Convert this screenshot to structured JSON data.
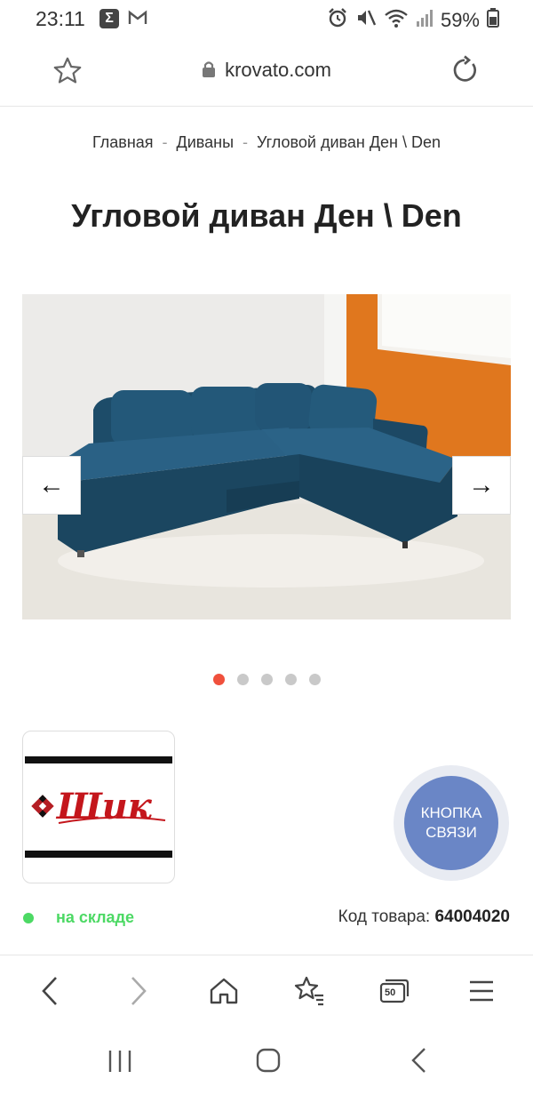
{
  "status_bar": {
    "time": "23:11",
    "battery": "59%",
    "icons": [
      "sigma-icon",
      "gmail-icon",
      "alarm-icon",
      "mute-icon",
      "wifi-icon",
      "signal-icon",
      "battery-icon"
    ]
  },
  "url_bar": {
    "url": "krovato.com"
  },
  "breadcrumb": {
    "items": [
      "Главная",
      "Диваны",
      "Угловой диван Ден \\ Den"
    ]
  },
  "product": {
    "title": "Угловой диван Ден \\ Den",
    "gallery": {
      "total_images": 5,
      "active_index": 0,
      "prev_label": "←",
      "next_label": "→"
    },
    "brand_logo_text": "Шик",
    "contact_button": "КНОПКА СВЯЗИ",
    "stock_status": "на складе",
    "sku_label": "Код товара:",
    "sku_value": "64004020"
  },
  "browser_toolbar": {
    "tab_count": "50",
    "icons": [
      "back-icon",
      "forward-icon",
      "home-icon",
      "bookmarks-icon",
      "tabs-icon",
      "menu-icon"
    ]
  },
  "colors": {
    "accent_dot": "#f0503c",
    "stock_green": "#4cd964",
    "contact_blue": "#6a86c6",
    "sofa_blue": "#1f4e6c",
    "wall_orange": "#e0771e"
  }
}
